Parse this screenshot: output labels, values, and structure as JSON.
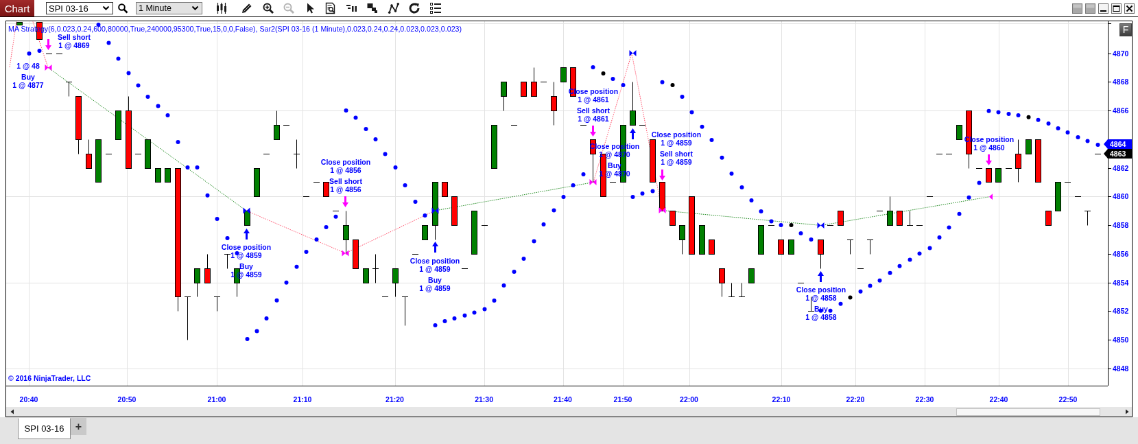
{
  "toolbar": {
    "chart_button": "Chart",
    "instrument": "SPI 03-16",
    "interval": "1 Minute",
    "tools": [
      {
        "kind": "candles",
        "disabled": false
      },
      {
        "kind": "pencil",
        "disabled": false
      },
      {
        "kind": "zoom_in",
        "disabled": false
      },
      {
        "kind": "zoom_out",
        "disabled": true
      },
      {
        "kind": "pointer",
        "disabled": false
      },
      {
        "kind": "data_box",
        "disabled": false
      },
      {
        "kind": "bars",
        "disabled": false
      },
      {
        "kind": "blocks",
        "disabled": false
      },
      {
        "kind": "line",
        "disabled": false
      },
      {
        "kind": "refresh",
        "disabled": false
      },
      {
        "kind": "list",
        "disabled": false
      }
    ]
  },
  "chart": {
    "indicator_label": "MA Strategy(6,0.023,0.24,600,80000,True,240000,95300,True,15,0,0,False), Sar2(SPI 03-16 (1 Minute),0.023,0.24,0.24,0.023,0.023,0.023)",
    "executions": [
      {
        "kind": "buy",
        "labels": [
          {
            "detail": "1 @ 48"
          },
          {
            "title": "Buy",
            "detail": "1 @ 4877"
          }
        ]
      },
      {
        "kind": "sell",
        "labels": [
          {
            "title": "Sell short",
            "detail": "1 @ 4869"
          }
        ]
      },
      {
        "kind": "buy",
        "labels": [
          {
            "title": "Close position",
            "detail": "1 @ 4859"
          },
          {
            "title": "Buy",
            "detail": "1 @ 4859"
          }
        ]
      },
      {
        "kind": "sell",
        "labels": [
          {
            "title": "Close position",
            "detail": "1 @ 4856"
          },
          {
            "title": "Sell short",
            "detail": "1 @ 4856"
          }
        ]
      },
      {
        "kind": "buy",
        "labels": [
          {
            "title": "Close position",
            "detail": "1 @ 4859"
          },
          {
            "title": "Buy",
            "detail": "1 @ 4859"
          }
        ]
      },
      {
        "kind": "sell",
        "labels": [
          {
            "title": "Close position",
            "detail": "1 @ 4861"
          },
          {
            "title": "Sell short",
            "detail": "1 @ 4861"
          }
        ]
      },
      {
        "kind": "buy",
        "labels": [
          {
            "title": "Close position",
            "detail": "1 @ 4870"
          },
          {
            "title": "Buy",
            "detail": "1 @ 4870"
          }
        ]
      },
      {
        "kind": "sell",
        "labels": [
          {
            "title": "Close position",
            "detail": "1 @ 4859"
          },
          {
            "title": "Sell short",
            "detail": "1 @ 4859"
          }
        ]
      },
      {
        "kind": "buy",
        "labels": [
          {
            "title": "Close position",
            "detail": "1 @ 4858"
          },
          {
            "title": "Buy",
            "detail": "1 @ 4858"
          }
        ]
      },
      {
        "kind": "sell",
        "labels": [
          {
            "title": "Close position",
            "detail": "1 @ 4860"
          }
        ]
      }
    ],
    "copyright": "© 2016 NinjaTrader, LLC",
    "corner_button": "F",
    "price_labels": [
      "4870",
      "4868",
      "4866",
      "4862",
      "4860",
      "4858",
      "4856",
      "4854",
      "4852",
      "4850",
      "4848"
    ],
    "price_flags": [
      {
        "text": "4864",
        "color": "#0000ff"
      },
      {
        "text": "4863",
        "color": "#000000"
      }
    ],
    "time_labels": [
      "20:40",
      "20:50",
      "21:00",
      "21:10",
      "21:20",
      "21:30",
      "21:40",
      "21:50",
      "22:00",
      "22:10",
      "22:20",
      "22:30",
      "22:40",
      "22:50"
    ]
  },
  "tabs": [
    {
      "label": "SPI 03-16",
      "selected": true
    }
  ],
  "add_tab": "+"
}
